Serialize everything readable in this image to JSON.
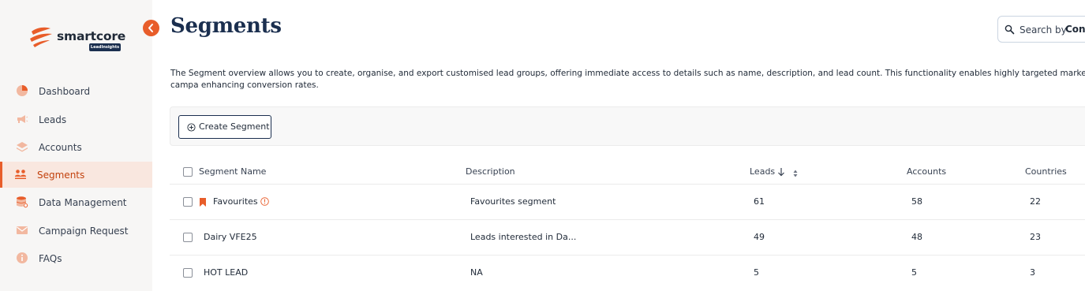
{
  "brand": {
    "name": "smartcore",
    "badge": "LeadInsights",
    "accent": "#e85d2a",
    "navy": "#1b2f4f"
  },
  "sidebar": {
    "items": [
      {
        "label": "Dashboard",
        "icon": "pie-chart-icon",
        "active": false
      },
      {
        "label": "Leads",
        "icon": "megaphone-icon",
        "active": false
      },
      {
        "label": "Accounts",
        "icon": "layers-icon",
        "active": false
      },
      {
        "label": "Segments",
        "icon": "users-icon",
        "active": true
      },
      {
        "label": "Data Management",
        "icon": "database-icon",
        "active": false
      },
      {
        "label": "Campaign Request",
        "icon": "mail-icon",
        "active": false
      },
      {
        "label": "FAQs",
        "icon": "info-icon",
        "active": false
      }
    ]
  },
  "header": {
    "title": "Segments",
    "search_label": "Search by",
    "search_value": "Con"
  },
  "description": "The Segment overview allows you to create, organise, and export customised lead groups, offering immediate access to details such as name, description, and lead count. This functionality enables highly targeted marketing campa enhancing conversion rates.",
  "toolbar": {
    "create_label": "Create Segment"
  },
  "table": {
    "columns": {
      "name": "Segment Name",
      "description": "Description",
      "leads": "Leads",
      "accounts": "Accounts",
      "countries": "Countries"
    },
    "rows": [
      {
        "name": "Favourites",
        "description": "Favourites segment",
        "leads": "61",
        "accounts": "58",
        "countries": "22",
        "favourite": true
      },
      {
        "name": "Dairy VFE25",
        "description": "Leads interested in Da...",
        "leads": "49",
        "accounts": "48",
        "countries": "23",
        "favourite": false
      },
      {
        "name": "HOT LEAD",
        "description": "NA",
        "leads": "5",
        "accounts": "5",
        "countries": "3",
        "favourite": false
      }
    ]
  }
}
